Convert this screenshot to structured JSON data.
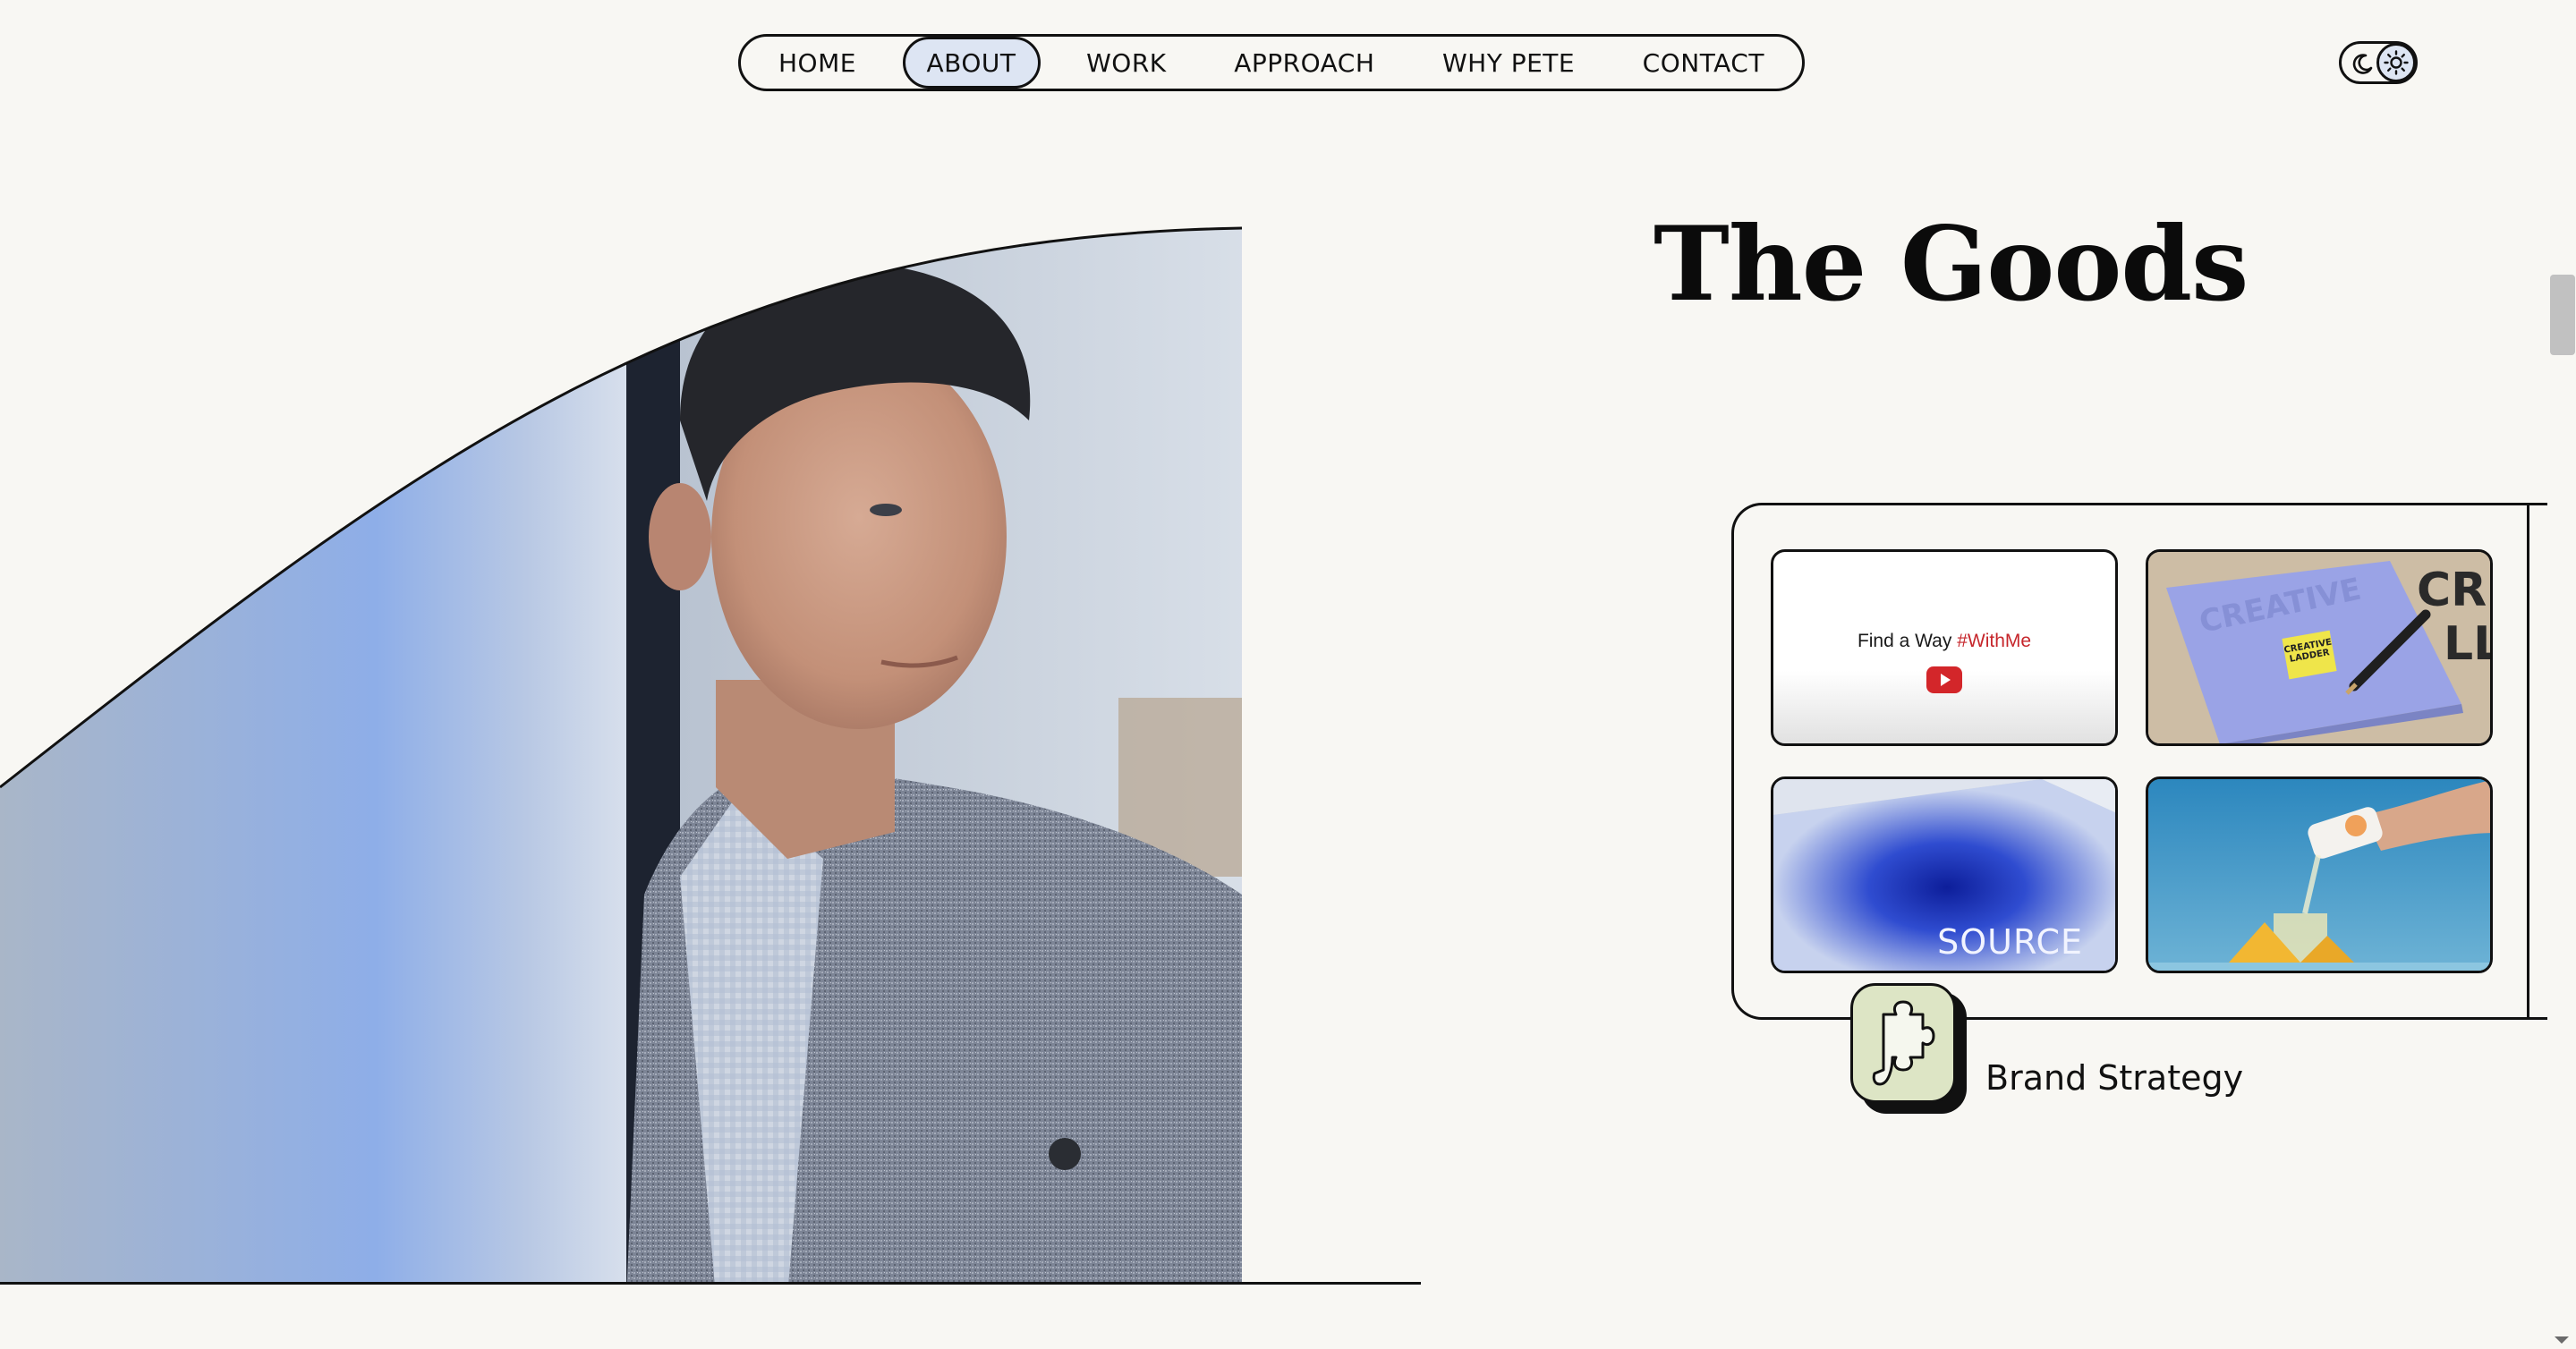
{
  "nav": {
    "items": [
      {
        "label": "HOME"
      },
      {
        "label": "ABOUT",
        "active": true
      },
      {
        "label": "WORK"
      },
      {
        "label": "APPROACH"
      },
      {
        "label": "WHY PETE"
      },
      {
        "label": "CONTACT"
      }
    ]
  },
  "theme_toggle": {
    "icons": [
      "moon-icon",
      "sun-icon"
    ],
    "selected": "sun-icon"
  },
  "section": {
    "heading": "The Goods"
  },
  "portfolio": {
    "tiles": [
      {
        "name": "find-a-way-video-tile",
        "text": "Find a Way ",
        "hashtag": "#WithMe",
        "icon": "youtube-play-icon"
      },
      {
        "name": "creative-ladder-notebook-tile",
        "note_text": "CREATIVE LADDER"
      },
      {
        "name": "source-packaging-tile",
        "logo": "SOURCE"
      },
      {
        "name": "pineapple-drink-tile"
      }
    ]
  },
  "service": {
    "icon": "puzzle-piece-icon",
    "label": "Brand Strategy"
  },
  "colors": {
    "background": "#f8f7f3",
    "nav_active": "#dde5f3",
    "badge": "#dde5c5",
    "ink": "#111111",
    "hashtag": "#c6262b"
  }
}
